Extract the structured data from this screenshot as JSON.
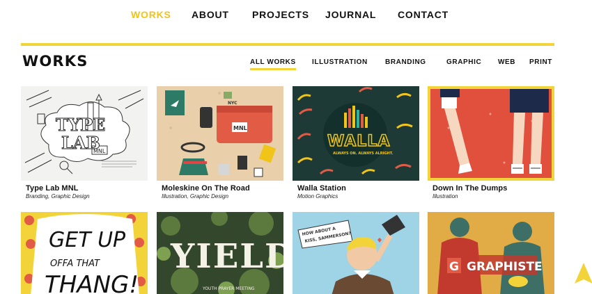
{
  "nav": {
    "items": [
      {
        "label": "WORKS"
      },
      {
        "label": "ABOUT"
      },
      {
        "label": "PROJECTS"
      },
      {
        "label": "JOURNAL"
      },
      {
        "label": "CONTACT"
      }
    ]
  },
  "works": {
    "title": "WORKS",
    "filters": [
      {
        "label": "ALL WORKS"
      },
      {
        "label": "ILLUSTRATION"
      },
      {
        "label": "BRANDING"
      },
      {
        "label": "GRAPHIC"
      },
      {
        "label": "WEB"
      },
      {
        "label": "PRINT"
      }
    ]
  },
  "projects": [
    {
      "title": "Type Lab MNL",
      "category": "Branding, Graphic Design",
      "art_text": [
        "TYPE",
        "LAB",
        "MNL"
      ]
    },
    {
      "title": "Moleskine On The Road",
      "category": "Illustration, Graphic Design",
      "art_text": [
        "MNL",
        "NYC"
      ]
    },
    {
      "title": "Walla Station",
      "category": "Motion Graphics",
      "art_text": [
        "WALLA",
        "ALWAYS ON. ALWAYS ALRIGHT."
      ]
    },
    {
      "title": "Down In The Dumps",
      "category": "Illustration",
      "art_text": []
    },
    {
      "art_text": [
        "GET UP",
        "OFFA THAT",
        "THANG!"
      ]
    },
    {
      "art_text": [
        "YIELD",
        "YOUTH PRAYER MEETING"
      ]
    },
    {
      "art_text": [
        "HOW ABOUT A",
        "KISS, SAMMERSON?"
      ]
    },
    {
      "art_text": [
        "G",
        "GRAPHISTE"
      ]
    }
  ],
  "colors": {
    "accent": "#f3d33a",
    "active_nav": "#f0c419",
    "text": "#111111"
  },
  "icons": {
    "back_to_top": "up-triangle-icon"
  }
}
